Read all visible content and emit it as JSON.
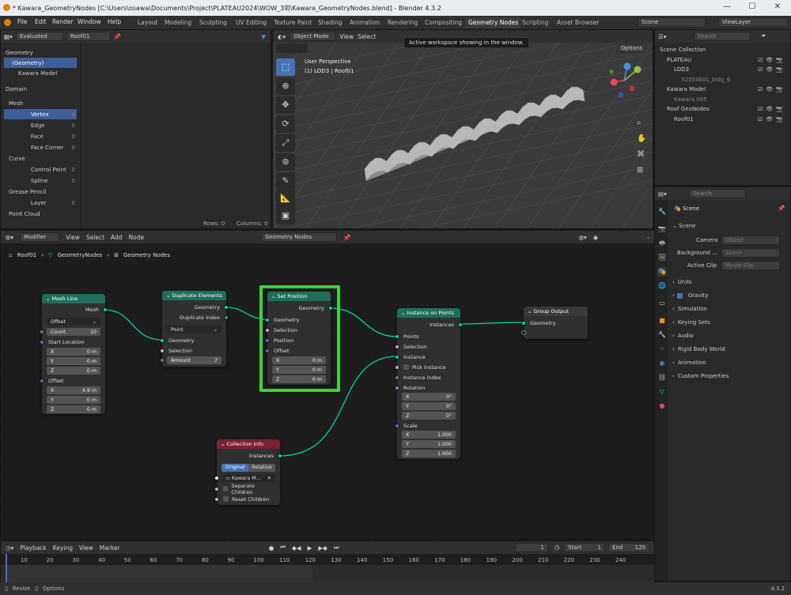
{
  "titlebar": {
    "title": "* Kawara_GeometryNodes [C:\\Users\\osawa\\Documents\\Project\\PLATEAU2024\\WOW_3회\\Kawara_GeometryNodes.blend] - Blender 4.3.2",
    "minimize": "—",
    "maximize": "☐",
    "close": "✕"
  },
  "menubar": {
    "items": [
      "File",
      "Edit",
      "Render",
      "Window",
      "Help"
    ],
    "workspaces": [
      "Layout",
      "Modeling",
      "Sculpting",
      "UV Editing",
      "Texture Paint",
      "Shading",
      "Animation",
      "Rendering",
      "Compositing",
      "Geometry Nodes",
      "Scripting",
      "Asset Browser"
    ],
    "active_workspace": "Geometry Nodes",
    "scene": "Scene",
    "view_layer": "ViewLayer"
  },
  "tooltip": "Active workspace showing in the window.",
  "spreadsheet": {
    "mode": "Evaluated",
    "object": "Roof01",
    "tree": [
      {
        "label": "Geometry",
        "indent": 0,
        "kind": "section"
      },
      {
        "label": "(Geometry)",
        "indent": 1,
        "sel": true
      },
      {
        "label": "Kawara Model",
        "indent": 2
      }
    ],
    "domain_title": "Domain",
    "domains": [
      {
        "label": "Mesh",
        "kind": "section",
        "count": ""
      },
      {
        "label": "Vertex",
        "count": "0",
        "sel": true
      },
      {
        "label": "Edge",
        "count": "0"
      },
      {
        "label": "Face",
        "count": "0"
      },
      {
        "label": "Face Corner",
        "count": "0"
      },
      {
        "label": "Curve",
        "kind": "section",
        "count": ""
      },
      {
        "label": "Control Point",
        "count": "0"
      },
      {
        "label": "Spline",
        "count": "0"
      },
      {
        "label": "Grease Pencil",
        "kind": "section",
        "count": ""
      },
      {
        "label": "Layer",
        "count": "0"
      },
      {
        "label": "Point Cloud",
        "kind": "section",
        "count": ""
      }
    ],
    "rows": "Rows: 0",
    "columns": "Columns: 0"
  },
  "viewport": {
    "mode": "Object Mode",
    "menus": [
      "View",
      "Select",
      "Add",
      "Object"
    ],
    "perspective": "User Perspective",
    "collection": "(1) LOD3 | Roof01",
    "options": "Options"
  },
  "outliner": {
    "search": "Search",
    "items": [
      {
        "label": "Scene Collection",
        "indent": 0
      },
      {
        "label": "PLATEAU",
        "indent": 1
      },
      {
        "label": "LOD3",
        "indent": 2
      },
      {
        "label": "52354601_bldg_6",
        "indent": 3,
        "dim": true
      },
      {
        "label": "Kawara Model",
        "indent": 1
      },
      {
        "label": "Kawara.005",
        "indent": 2,
        "dim": true
      },
      {
        "label": "Roof GeoNodes",
        "indent": 1
      },
      {
        "label": "Roof01",
        "indent": 2
      }
    ]
  },
  "properties": {
    "search": "Search",
    "scene_label": "Scene",
    "section_scene": "Scene",
    "camera_label": "Camera",
    "camera_ph": "Object",
    "bg_label": "Background ...",
    "bg_ph": "Scene",
    "clip_label": "Active Clip",
    "clip_ph": "Movie Clip",
    "sections": [
      "Units",
      "Gravity",
      "Simulation",
      "Keying Sets",
      "Audio",
      "Rigid Body World",
      "Animation",
      "Custom Properties"
    ]
  },
  "node_editor": {
    "editor": "Modifier",
    "menus": [
      "View",
      "Select",
      "Add",
      "Node"
    ],
    "tree_name": "Geometry Nodes",
    "breadcrumb": [
      "Roof01",
      "GeometryNodes",
      "Geometry Nodes"
    ],
    "mesh_line": {
      "title": "Mesh Line",
      "out": "Mesh",
      "mode": "Offset",
      "count_label": "Count",
      "count": "10",
      "start": "Start Location",
      "sx": "0 m",
      "sy": "0 m",
      "sz": "0 m",
      "offset": "Offset",
      "ox": "4.9 m",
      "oy": "0 m",
      "oz": "0 m"
    },
    "dup": {
      "title": "Duplicate Elements",
      "o1": "Geometry",
      "o2": "Duplicate Index",
      "domain": "Point",
      "i1": "Geometry",
      "i2": "Selection",
      "amount_label": "Amount",
      "amount": "7"
    },
    "setpos": {
      "title": "Set Position",
      "out": "Geometry",
      "i1": "Geometry",
      "i2": "Selection",
      "i3": "Position",
      "i4": "Offset",
      "x": "0 m",
      "y": "0 m",
      "z": "0 m"
    },
    "iop": {
      "title": "Instance on Points",
      "out": "Instances",
      "i1": "Points",
      "i2": "Selection",
      "i3": "Instance",
      "pick": "Pick Instance",
      "idx": "Instance Index",
      "rot": "Rotation",
      "rx": "0°",
      "ry": "0°",
      "rz": "0°",
      "scale": "Scale",
      "sx": "1.000",
      "sy": "1.000",
      "sz": "1.000"
    },
    "out": {
      "title": "Group Output",
      "i1": "Geometry"
    },
    "col": {
      "title": "Collection Info",
      "out": "Instances",
      "orig": "Original",
      "rel": "Relative",
      "coll": "Kawara M...",
      "sep": "Separate Children",
      "reset": "Reset Children"
    }
  },
  "timeline": {
    "menus": [
      "Playback",
      "Keying",
      "View",
      "Marker"
    ],
    "frame": "1",
    "start_label": "Start",
    "start": "1",
    "end_label": "End",
    "end": "120",
    "ticks": [
      "10",
      "20",
      "30",
      "40",
      "50",
      "60",
      "70",
      "80",
      "90",
      "100",
      "110",
      "120",
      "130",
      "140",
      "150",
      "160",
      "170",
      "180",
      "190",
      "200",
      "210",
      "220",
      "230",
      "240"
    ]
  },
  "status": {
    "resize": "Resize",
    "options": "Options",
    "version": "4.3.2"
  }
}
